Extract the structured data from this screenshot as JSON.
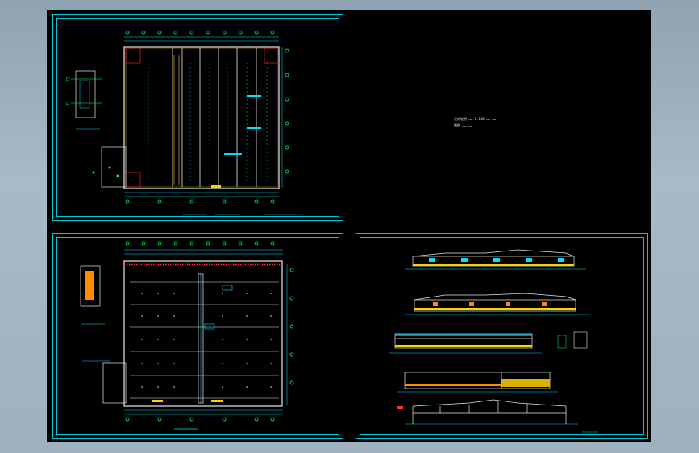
{
  "sheets": [
    {
      "id": "sheet-floor-plan-upper",
      "kind": "floor-plan"
    },
    {
      "id": "sheet-notes",
      "kind": "notes"
    },
    {
      "id": "sheet-floor-plan-lower",
      "kind": "floor-plan"
    },
    {
      "id": "sheet-elevations-sections",
      "kind": "elevations"
    }
  ],
  "notes": {
    "line1": "设计说明  …… 1:100 …… ……",
    "line2": "图例  …… ……"
  },
  "colors": {
    "sheet_border": "#00c8d8",
    "axis_green": "#00ff66",
    "wall_white": "#e8e8e8",
    "dimension_cyan": "#00e0ff",
    "accent_orange": "#ff8c00",
    "accent_red": "#ff3030",
    "accent_yellow": "#ffd000"
  }
}
